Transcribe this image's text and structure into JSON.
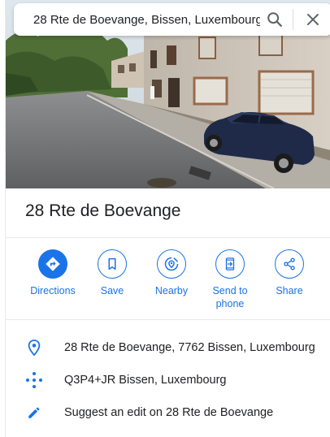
{
  "search": {
    "value": "28 Rte de Boevange, Bissen, Luxembourg",
    "search_icon": "search-icon",
    "close_icon": "close-icon"
  },
  "place": {
    "title": "28 Rte de Boevange"
  },
  "actions": [
    {
      "label": "Directions",
      "icon": "directions-icon"
    },
    {
      "label": "Save",
      "icon": "bookmark-icon"
    },
    {
      "label": "Nearby",
      "icon": "nearby-icon"
    },
    {
      "label": "Send to phone",
      "icon": "send-to-phone-icon"
    },
    {
      "label": "Share",
      "icon": "share-icon"
    }
  ],
  "info": {
    "address": "28 Rte de Boevange, 7762 Bissen, Luxembourg",
    "plus_code": "Q3P4+JR Bissen, Luxembourg",
    "suggest_edit": "Suggest an edit on 28 Rte de Boevange"
  },
  "colors": {
    "accent": "#1a73e8",
    "text": "#202124",
    "divider": "#e8eaed"
  }
}
